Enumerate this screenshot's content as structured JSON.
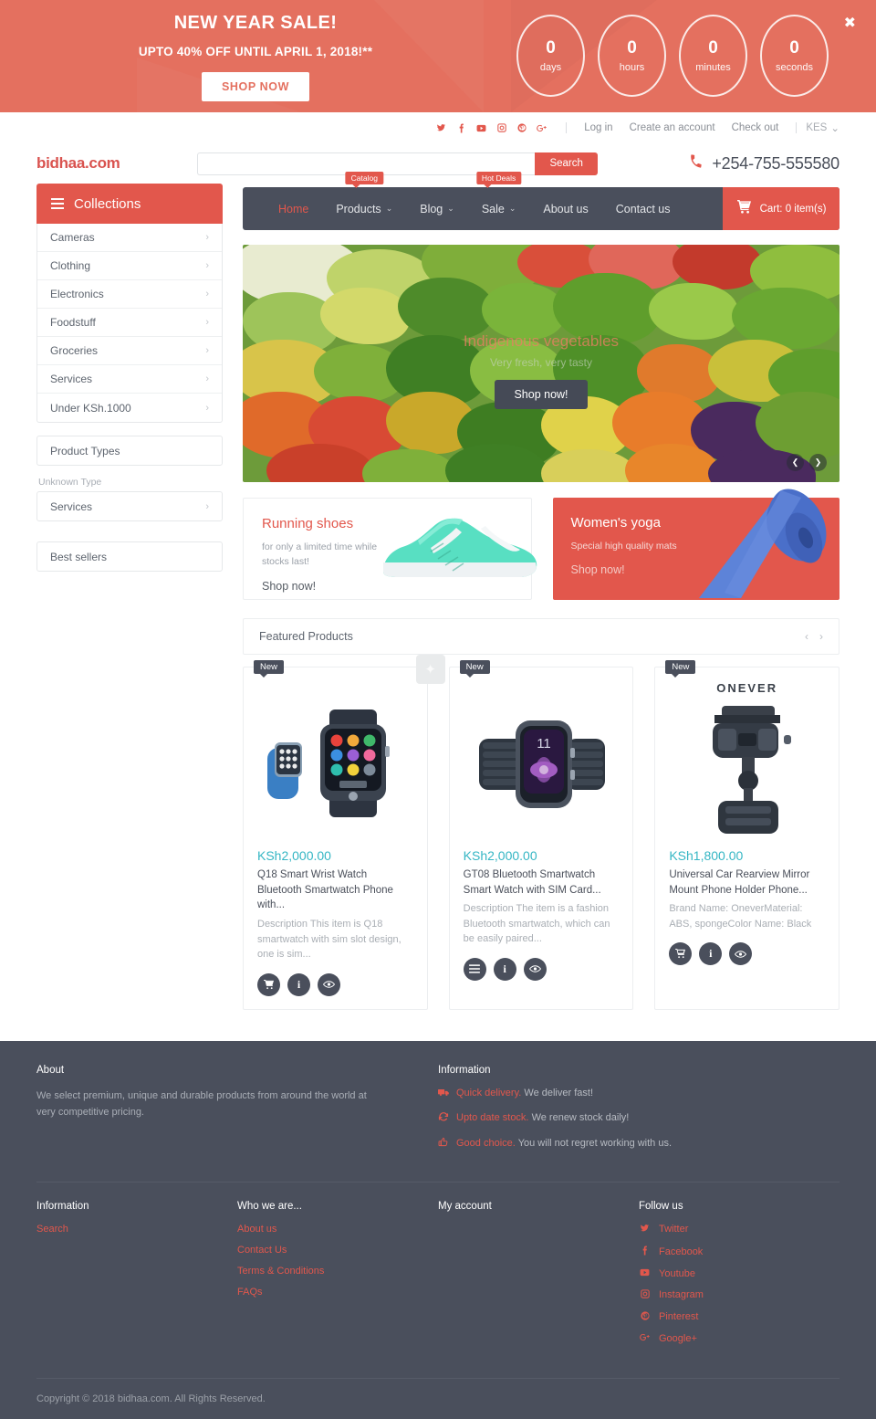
{
  "promo": {
    "title": "NEW YEAR SALE!",
    "subtitle": "UPTO 40% OFF UNTIL APRIL 1, 2018!**",
    "button": "SHOP NOW",
    "close_icon": "close-icon",
    "counters": [
      {
        "value": "0",
        "label": "days"
      },
      {
        "value": "0",
        "label": "hours"
      },
      {
        "value": "0",
        "label": "minutes"
      },
      {
        "value": "0",
        "label": "seconds"
      }
    ],
    "accent": "#e4705f"
  },
  "topbar": {
    "socials": [
      "twitter-icon",
      "facebook-icon",
      "youtube-icon",
      "instagram-icon",
      "pinterest-icon",
      "googleplus-icon"
    ],
    "links": [
      "Log in",
      "Create an account",
      "Check out"
    ],
    "currency": "KES"
  },
  "header": {
    "logo": "bidhaa.com",
    "search_placeholder": "",
    "search_value": "",
    "search_button": "Search",
    "phone": "+254-755-555580",
    "phone_icon": "phone-icon"
  },
  "sidebar": {
    "collections_title": "Collections",
    "collections": [
      "Cameras",
      "Clothing",
      "Electronics",
      "Foodstuff",
      "Groceries",
      "Services",
      "Under KSh.1000"
    ],
    "product_types_title": "Product Types",
    "unknown_type_label": "Unknown Type",
    "unknown_type_items": [
      "Services"
    ],
    "best_sellers_title": "Best sellers"
  },
  "nav": {
    "items": [
      {
        "label": "Home",
        "active": true,
        "caret": false,
        "badge": ""
      },
      {
        "label": "Products",
        "active": false,
        "caret": true,
        "badge": "Catalog"
      },
      {
        "label": "Blog",
        "active": false,
        "caret": true,
        "badge": ""
      },
      {
        "label": "Sale",
        "active": false,
        "caret": true,
        "badge": "Hot Deals"
      },
      {
        "label": "About us",
        "active": false,
        "caret": false,
        "badge": ""
      },
      {
        "label": "Contact us",
        "active": false,
        "caret": false,
        "badge": ""
      }
    ],
    "cart_label": "Cart: 0 item(s)",
    "cart_icon": "cart-icon"
  },
  "hero": {
    "title": "Indigenous vegetables",
    "subtitle": "Very fresh, very tasty",
    "button": "Shop now!",
    "prev_icon": "chevron-left-icon",
    "next_icon": "chevron-right-icon"
  },
  "promo_cards": [
    {
      "title": "Running shoes",
      "subtitle": "for only a limited time while stocks last!",
      "cta": "Shop now!",
      "image": "running-shoe-image"
    },
    {
      "title": "Women's yoga",
      "subtitle": "Special high quality mats",
      "cta": "Shop now!",
      "image": "yoga-mat-image"
    }
  ],
  "featured": {
    "title": "Featured Products",
    "prev_icon": "chevron-left-icon",
    "next_icon": "chevron-right-icon",
    "products": [
      {
        "badge": "New",
        "price": "KSh2,000.00",
        "name": "Q18 Smart Wrist Watch Bluetooth Smartwatch Phone with...",
        "description": "Description This item is Q18 smartwatch with sim slot design, one is sim...",
        "image": "q18-smartwatch-image",
        "actions": [
          "cart-icon",
          "info-icon",
          "eye-icon"
        ]
      },
      {
        "badge": "New",
        "price": "KSh2,000.00",
        "name": "GT08 Bluetooth Smartwatch Smart Watch with SIM Card...",
        "description": "Description The item is a fashion Bluetooth smartwatch, which can be easily paired...",
        "image": "gt08-smartwatch-image",
        "actions": [
          "list-icon",
          "info-icon",
          "eye-icon"
        ]
      },
      {
        "badge": "New",
        "price": "KSh1,800.00",
        "name": "Universal Car Rearview Mirror Mount Phone Holder Phone...",
        "description": "Brand Name: OneverMaterial: ABS, spongeColor Name: Black",
        "image": "car-mount-image",
        "brand": "ONEVER",
        "actions": [
          "cart-icon",
          "info-icon",
          "eye-icon"
        ]
      }
    ]
  },
  "footer": {
    "about_title": "About",
    "about_text": "We select premium, unique and durable products from around the world at very competitive pricing.",
    "information_title": "Information",
    "information_items": [
      {
        "icon": "truck-icon",
        "strong": "Quick delivery.",
        "text": "We deliver fast!"
      },
      {
        "icon": "refresh-icon",
        "strong": "Upto date stock.",
        "text": "We renew stock daily!"
      },
      {
        "icon": "thumbs-up-icon",
        "strong": "Good choice.",
        "text": "You will not regret working with us."
      }
    ],
    "columns": [
      {
        "title": "Information",
        "links": [
          "Search"
        ]
      },
      {
        "title": "Who we are...",
        "links": [
          "About us",
          "Contact Us",
          "Terms & Conditions",
          "FAQs"
        ]
      },
      {
        "title": "My account",
        "links": []
      }
    ],
    "follow_title": "Follow us",
    "follow": [
      {
        "icon": "twitter-icon",
        "label": "Twitter"
      },
      {
        "icon": "facebook-icon",
        "label": "Facebook"
      },
      {
        "icon": "youtube-icon",
        "label": "Youtube"
      },
      {
        "icon": "instagram-icon",
        "label": "Instagram"
      },
      {
        "icon": "pinterest-icon",
        "label": "Pinterest"
      },
      {
        "icon": "googleplus-icon",
        "label": "Google+"
      }
    ],
    "copyright": "Copyright © 2018 bidhaa.com. All Rights Reserved."
  }
}
